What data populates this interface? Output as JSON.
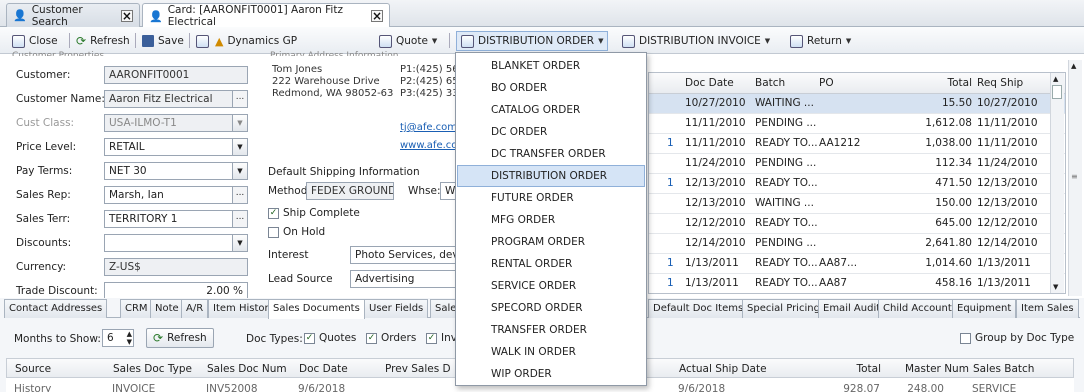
{
  "tabs": {
    "customer_search": "Customer Search",
    "card": "Card: [AARONFIT0001] Aaron Fitz Electrical"
  },
  "toolbar": {
    "close": "Close",
    "refresh": "Refresh",
    "save": "Save",
    "dynamics": "Dynamics GP",
    "quote": "Quote",
    "distribution_order": "DISTRIBUTION ORDER",
    "distribution_invoice": "DISTRIBUTION INVOICE",
    "return": "Return"
  },
  "form": {
    "header_partial": "Customer Properties",
    "customer_label": "Customer:",
    "customer_value": "AARONFIT0001",
    "name_label": "Customer Name:",
    "name_value": "Aaron Fitz Electrical",
    "class_label": "Cust Class:",
    "class_value": "USA-ILMO-T1",
    "price_label": "Price Level:",
    "price_value": "RETAIL",
    "pay_label": "Pay Terms:",
    "pay_value": "NET 30",
    "rep_label": "Sales Rep:",
    "rep_value": "Marsh, Ian",
    "terr_label": "Sales Terr:",
    "terr_value": "TERRITORY 1",
    "disc_label": "Discounts:",
    "disc_value": "",
    "cur_label": "Currency:",
    "cur_value": "Z-US$",
    "trade_label": "Trade Discount:",
    "trade_value": "2.00 %"
  },
  "address": {
    "header_partial": "Primary Address Information",
    "line1": "Tom Jones",
    "line2": "222 Warehouse Drive",
    "line3": "Redmond, WA 98052-63",
    "phone1": "P1:(425) 56",
    "phone2": "P2:(425) 65",
    "phone3": "P3:(425) 33",
    "email": "tj@afe.com",
    "web": "www.afe.co"
  },
  "shipping": {
    "header": "Default Shipping Information",
    "method_label": "Method",
    "method_value": "FEDEX GROUND",
    "whse_label": "Whse:",
    "whse_value": "W",
    "ship_complete": "Ship Complete",
    "on_hold": "On Hold",
    "interest_label": "Interest",
    "interest_value": "Photo Services, deve",
    "lead_label": "Lead Source",
    "lead_value": "Advertising"
  },
  "orders_grid": {
    "columns": [
      "Doc Date",
      "Batch",
      "PO",
      "Total",
      "Req Ship"
    ],
    "rows": [
      {
        "pre": "",
        "date": "10/27/2010",
        "batch": "WAITING ...",
        "po": "",
        "total": "15.50",
        "req": "10/27/2010",
        "selected": true
      },
      {
        "pre": "",
        "date": "11/11/2010",
        "batch": "PENDING ...",
        "po": "",
        "total": "1,612.08",
        "req": "11/11/2010"
      },
      {
        "pre": "1",
        "date": "11/11/2010",
        "batch": "READY TO...",
        "po": "AA1212",
        "total": "1,038.00",
        "req": "11/11/2010"
      },
      {
        "pre": "",
        "date": "11/24/2010",
        "batch": "PENDING ...",
        "po": "",
        "total": "112.34",
        "req": "11/24/2010"
      },
      {
        "pre": "1",
        "date": "12/13/2010",
        "batch": "READY TO...",
        "po": "",
        "total": "471.50",
        "req": "12/13/2010"
      },
      {
        "pre": "",
        "date": "12/13/2010",
        "batch": "WAITING ...",
        "po": "",
        "total": "150.00",
        "req": "12/13/2010"
      },
      {
        "pre": "",
        "date": "12/12/2010",
        "batch": "READY TO...",
        "po": "",
        "total": "645.00",
        "req": "12/12/2010"
      },
      {
        "pre": "",
        "date": "12/14/2010",
        "batch": "PENDING ...",
        "po": "",
        "total": "2,641.80",
        "req": "12/14/2010"
      },
      {
        "pre": "1",
        "date": "1/13/2011",
        "batch": "READY TO...",
        "po": "AA87...",
        "total": "1,014.60",
        "req": "1/13/2011"
      },
      {
        "pre": "1",
        "date": "1/13/2011",
        "batch": "READY TO...",
        "po": "AA87",
        "total": "458.16",
        "req": "1/13/2011"
      }
    ]
  },
  "bottom_tabs": {
    "contact": "Contact Addresses",
    "crm": "CRM",
    "note": "Note",
    "ar": "A/R",
    "item_history": "Item History",
    "sales_docs": "Sales Documents",
    "user_fields": "User Fields",
    "sales_g": "Sales G",
    "default_doc": "Default Doc Items",
    "special": "Special Pricing",
    "email_audit": "Email Audit",
    "child": "Child Accounts",
    "equipment": "Equipment",
    "item_sales": "Item Sales"
  },
  "sales_docs": {
    "months_label": "Months to Show:",
    "months_value": "6",
    "refresh": "Refresh",
    "doc_types_label": "Doc Types:",
    "quotes": "Quotes",
    "orders": "Orders",
    "inv": "Inv",
    "group_by": "Group by Doc Type",
    "columns": {
      "source": "Source",
      "type": "Sales Doc Type",
      "num": "Sales Doc Num",
      "date": "Doc Date",
      "prev": "Prev Sales D",
      "ship": "Actual Ship Date",
      "total": "Total",
      "master": "Master Num",
      "batch": "Sales Batch"
    },
    "partial_row": {
      "source": "History",
      "type": "INVOICE",
      "num": "INV52008",
      "date": "9/6/2018",
      "ship": "9/6/2018",
      "total": "928.07",
      "master": "248.00",
      "batch": "SERVICE"
    }
  },
  "menu": {
    "items": [
      "BLANKET ORDER",
      "BO ORDER",
      "CATALOG ORDER",
      "DC ORDER",
      "DC TRANSFER ORDER",
      "DISTRIBUTION ORDER",
      "FUTURE ORDER",
      "MFG ORDER",
      "PROGRAM ORDER",
      "RENTAL ORDER",
      "SERVICE ORDER",
      "SPECORD ORDER",
      "TRANSFER ORDER",
      "WALK IN ORDER",
      "WIP ORDER"
    ],
    "highlighted_index": 5
  }
}
